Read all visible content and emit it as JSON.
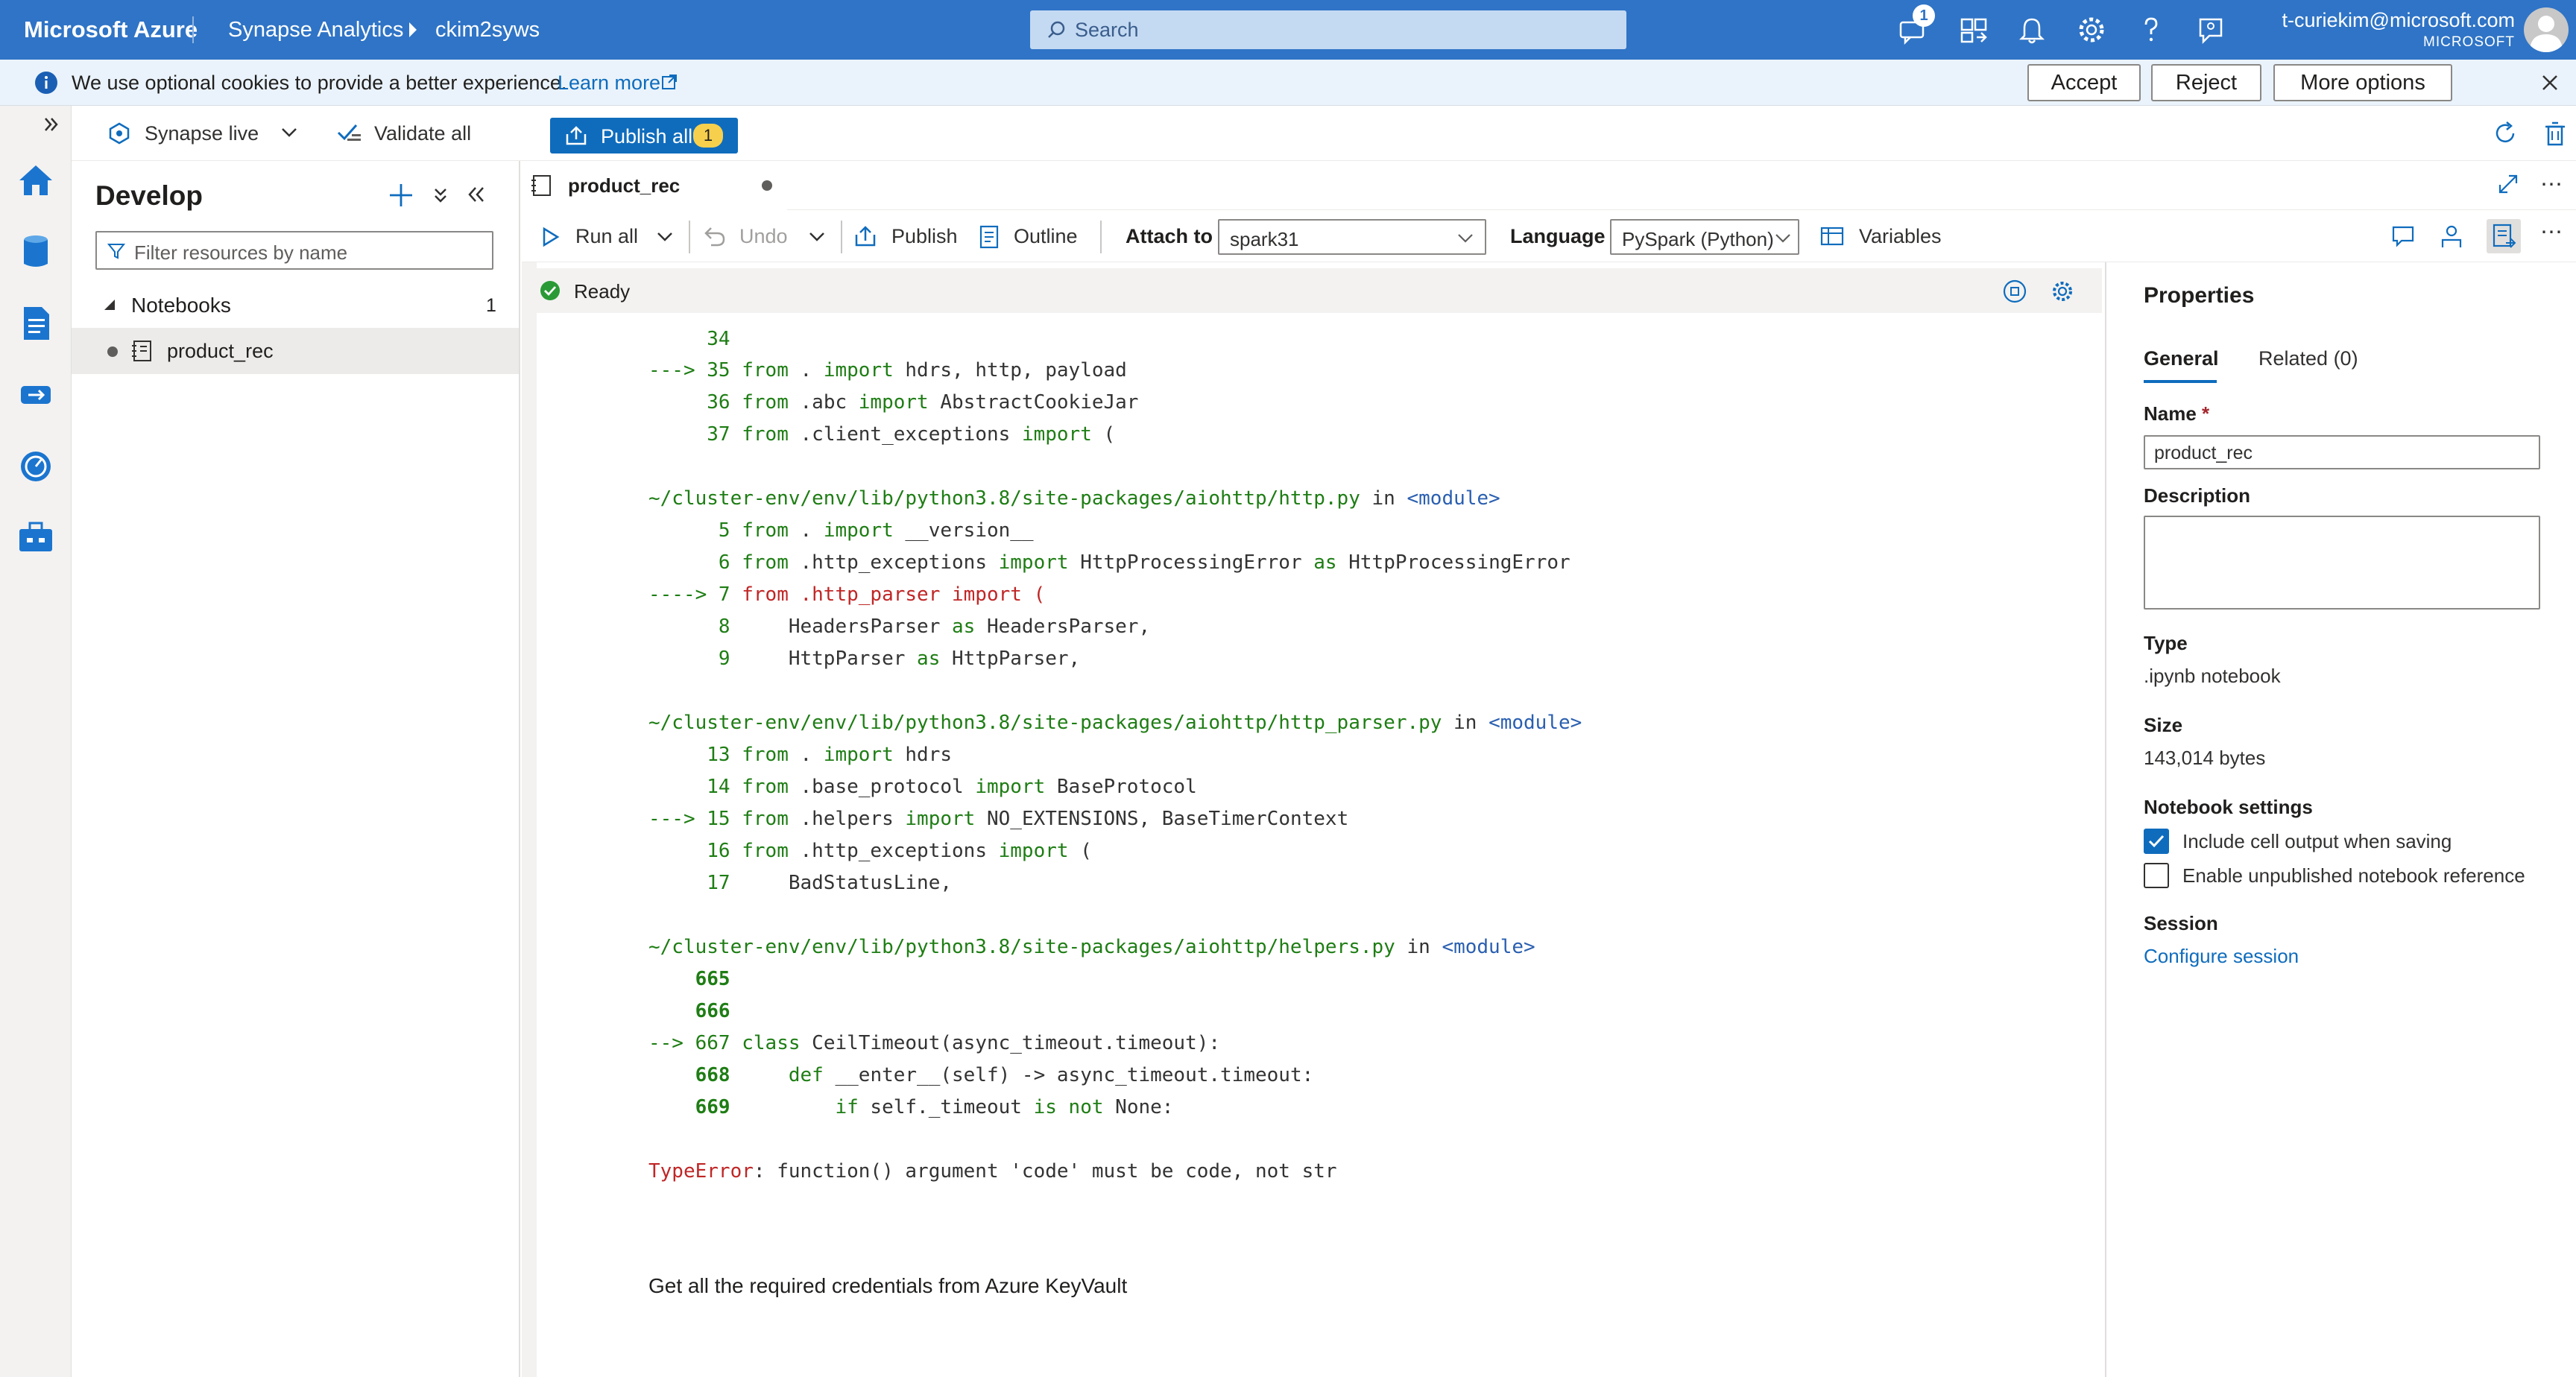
{
  "topbar": {
    "brand": "Microsoft Azure",
    "service": "Synapse Analytics",
    "workspace": "ckim2syws",
    "search_placeholder": "Search",
    "notif_count": "1",
    "user_email": "t-curiekim@microsoft.com",
    "user_org": "MICROSOFT"
  },
  "cookie": {
    "message": "We use optional cookies to provide a better experience.",
    "learn_more": "Learn more",
    "accept": "Accept",
    "reject": "Reject",
    "more": "More options"
  },
  "toolbar": {
    "mode": "Synapse live",
    "validate": "Validate all",
    "publish": "Publish all",
    "publish_count": "1"
  },
  "develop": {
    "title": "Develop",
    "filter_placeholder": "Filter resources by name",
    "group_label": "Notebooks",
    "group_count": "1",
    "item": "product_rec"
  },
  "notebook": {
    "tab": "product_rec",
    "run_all": "Run all",
    "undo": "Undo",
    "publish": "Publish",
    "outline": "Outline",
    "attach_label": "Attach to",
    "attach_value": "spark31",
    "language_label": "Language",
    "language_value": "PySpark (Python)",
    "variables": "Variables",
    "status": "Ready",
    "markdown": "Get all the required credentials from Azure KeyVault"
  },
  "code": {
    "l34": "     34",
    "l35a": "---> 35 ",
    "l35b": "from",
    "l35c": " . ",
    "l35d": "import",
    "l35e": " hdrs, http, payload",
    "l36a": "     36 ",
    "l36b": "from",
    "l36c": " .abc ",
    "l36d": "import",
    "l36e": " AbstractCookieJar",
    "l37a": "     37 ",
    "l37b": "from",
    "l37c": " .client_exceptions ",
    "l37d": "import",
    "l37e": " (",
    "p1": "~/cluster-env/env/lib/python3.8/site-packages/aiohttp/http.py",
    "in": " in ",
    "mod": "<module>",
    "l5a": "      5 ",
    "l5b": "from",
    "l5c": " . ",
    "l5d": "import",
    "l5e": " __version__",
    "l6a": "      6 ",
    "l6b": "from",
    "l6c": " .http_exceptions ",
    "l6d": "import",
    "l6e": " HttpProcessingError ",
    "l6f": "as",
    "l6g": " HttpProcessingError",
    "l7a": "----> 7 ",
    "l7b": "from .http_parser import (",
    "l8a": "      8 ",
    "l8b": "    HeadersParser ",
    "l8c": "as",
    "l8d": " HeadersParser,",
    "l9a": "      9 ",
    "l9b": "    HttpParser ",
    "l9c": "as",
    "l9d": " HttpParser,",
    "p2": "~/cluster-env/env/lib/python3.8/site-packages/aiohttp/http_parser.py",
    "l13a": "     13 ",
    "l13b": "from",
    "l13c": " . ",
    "l13d": "import",
    "l13e": " hdrs",
    "l14a": "     14 ",
    "l14b": "from",
    "l14c": " .base_protocol ",
    "l14d": "import",
    "l14e": " BaseProtocol",
    "l15a": "---> 15 ",
    "l15b": "from",
    "l15c": " .helpers ",
    "l15d": "import",
    "l15e": " NO_EXTENSIONS, BaseTimerContext",
    "l16a": "     16 ",
    "l16b": "from",
    "l16c": " .http_exceptions ",
    "l16d": "import",
    "l16e": " (",
    "l17a": "     17 ",
    "l17b": "    BadStatusLine,",
    "p3": "~/cluster-env/env/lib/python3.8/site-packages/aiohttp/helpers.py",
    "l665": "    665",
    "l666": "    666",
    "l667a": "--> 667 ",
    "l667b": "class",
    "l667c": " CeilTimeout(async_timeout.timeout):",
    "l668a": "    668 ",
    "l668b": "    ",
    "l668c": "def",
    "l668d": " __enter__(self) -> async_timeout.timeout:",
    "l669a": "    669 ",
    "l669b": "        ",
    "l669c": "if",
    "l669d": " self._timeout ",
    "l669e": "is not",
    "l669f": " None:",
    "err_type": "TypeError",
    "err_msg": ": function() argument 'code' must be code, not str"
  },
  "properties": {
    "title": "Properties",
    "tab_general": "General",
    "tab_related": "Related (0)",
    "name_label": "Name",
    "name_value": "product_rec",
    "desc_label": "Description",
    "type_label": "Type",
    "type_value": ".ipynb notebook",
    "size_label": "Size",
    "size_value": "143,014 bytes",
    "settings_label": "Notebook settings",
    "opt1": "Include cell output when saving",
    "opt2": "Enable unpublished notebook reference",
    "session_label": "Session",
    "configure": "Configure session"
  },
  "colors": {
    "brand_blue": "#2f74c6",
    "accent": "#0f6cbd",
    "error": "#c02626",
    "code_green": "#1e7d14"
  }
}
